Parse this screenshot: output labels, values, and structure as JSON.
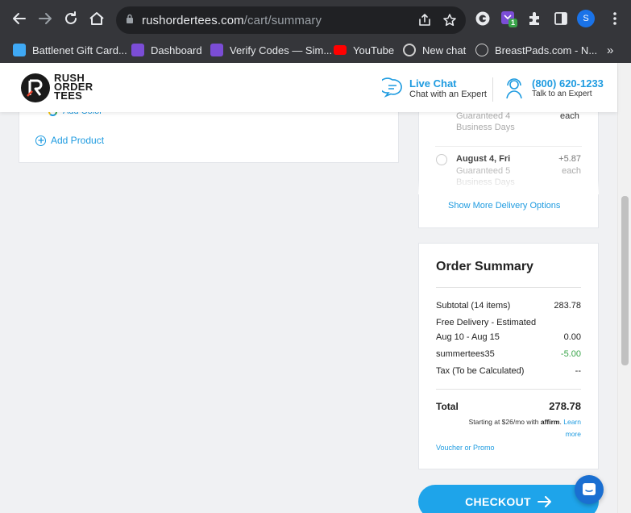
{
  "browser": {
    "url_domain": "rushordertees.com",
    "url_path": "/cart/summary",
    "profile_initial": "S",
    "extension_badge": "1",
    "bookmarks": [
      {
        "label": "Battlenet Gift Card...",
        "icon": "battlenet-icon",
        "color": "#3fa9f5"
      },
      {
        "label": "Dashboard",
        "icon": "dashboard-icon",
        "color": "#7b4dd6"
      },
      {
        "label": "Verify Codes — Sim...",
        "icon": "verify-icon",
        "color": "#7b4dd6"
      },
      {
        "label": "YouTube",
        "icon": "youtube-icon",
        "color": "#ff0000"
      },
      {
        "label": "New chat",
        "icon": "openai-icon",
        "color": "#cfcfcf"
      },
      {
        "label": "BreastPads.com - N...",
        "icon": "bp-icon",
        "color": "#cfcfcf"
      }
    ],
    "more_bookmarks": "»"
  },
  "header": {
    "logo_lines": [
      "RUSH",
      "ORDER",
      "TEES"
    ],
    "live_chat_title": "Live Chat",
    "live_chat_sub": "Chat with an Expert",
    "phone": "(800) 620-1233",
    "phone_sub": "Talk to an Expert"
  },
  "products": {
    "add_color": "Add Color",
    "add_product": "Add Product"
  },
  "delivery": {
    "option1_sub": "Guaranteed 4",
    "option1_sub2": "Business Days",
    "option1_price": "each",
    "option2_date": "August 4, Fri",
    "option2_sub": "Guaranteed 5",
    "option2_sub2": "Business Days",
    "option2_price": "+5.87",
    "option2_unit": "each",
    "show_more": "Show More Delivery Options"
  },
  "summary": {
    "title": "Order Summary",
    "subtotal_label": "Subtotal (14 items)",
    "subtotal_value": "283.78",
    "delivery_label": "Free Delivery - Estimated",
    "delivery_dates": "Aug 10 - Aug 15",
    "delivery_value": "0.00",
    "promo_label": "summertees35",
    "promo_value": "-5.00",
    "tax_label": "Tax (To be Calculated)",
    "tax_value": "--",
    "total_label": "Total",
    "total_value": "278.78",
    "affirm_text": "Starting at $26/mo with",
    "affirm_brand": "affirm",
    "learn": "Learn",
    "more": "more",
    "voucher": "Voucher or Promo"
  },
  "checkout_label": "CHECKOUT",
  "colors": {
    "accent": "#1e9be0",
    "discount": "#3aa54a",
    "checkout": "#1ea4ea"
  }
}
